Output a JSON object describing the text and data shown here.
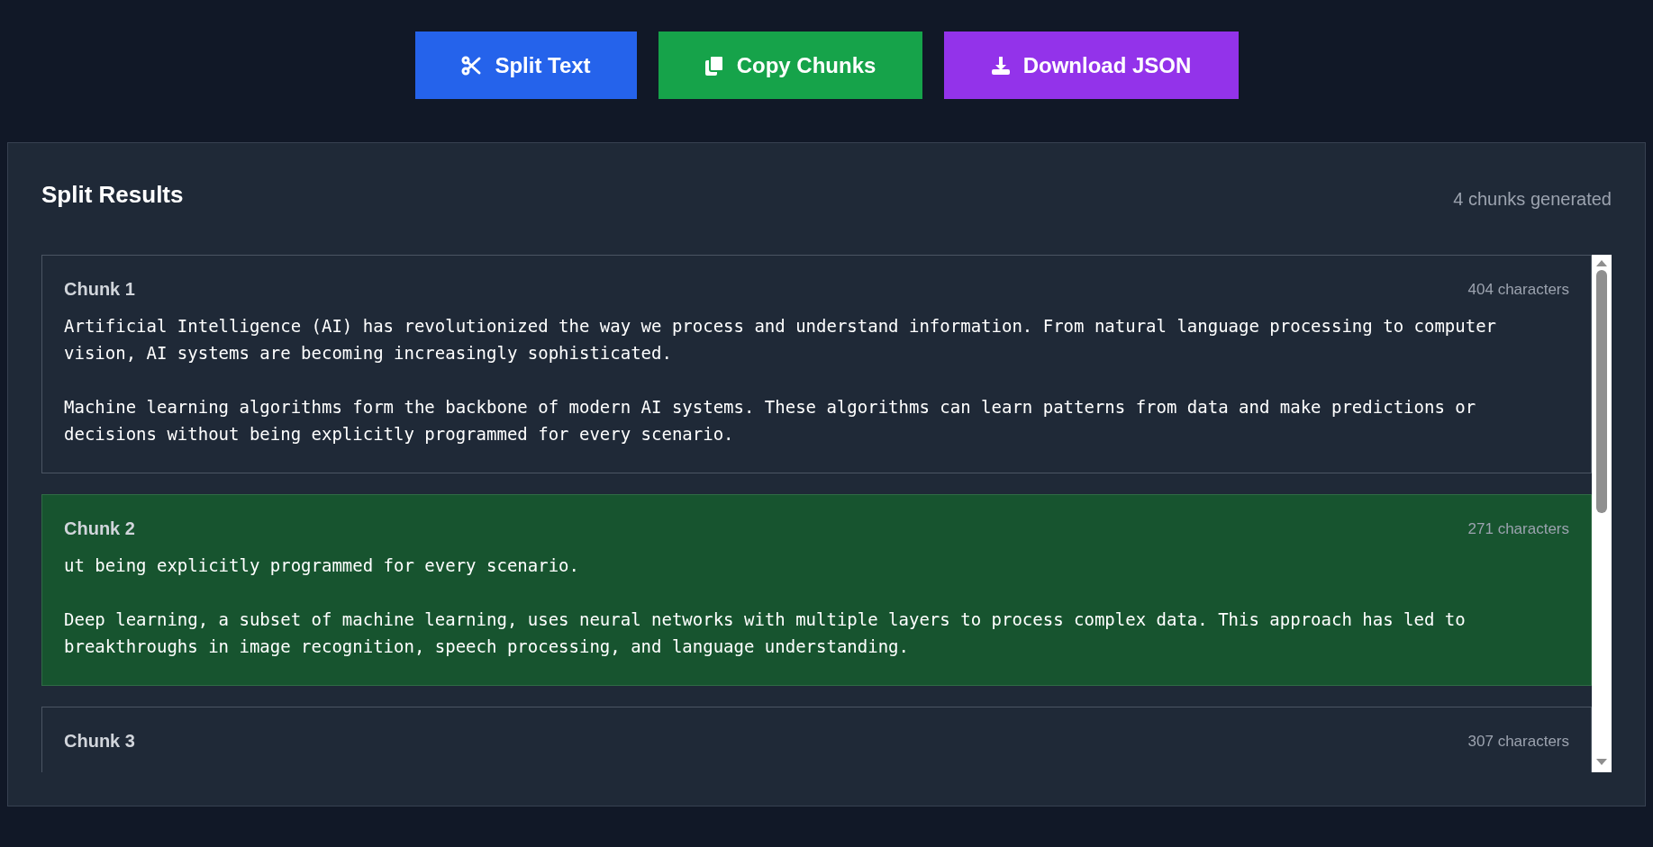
{
  "toolbar": [
    {
      "kind": "split",
      "label": "Split Text",
      "color": "#2563eb"
    },
    {
      "kind": "copy",
      "label": "Copy Chunks",
      "color": "#16a34a"
    },
    {
      "kind": "download",
      "label": "Download JSON",
      "color": "#9333ea"
    }
  ],
  "results": {
    "title": "Split Results",
    "count": "4 chunks generated",
    "chunks": [
      {
        "title": "Chunk 1",
        "length": "404 characters",
        "selected": false,
        "text": "Artificial Intelligence (AI) has revolutionized the way we process and understand information. From natural language processing to computer vision, AI systems are becoming increasingly sophisticated.\n\nMachine learning algorithms form the backbone of modern AI systems. These algorithms can learn patterns from data and make predictions or decisions without being explicitly programmed for every scenario."
      },
      {
        "title": "Chunk 2",
        "length": "271 characters",
        "selected": true,
        "text": "ut being explicitly programmed for every scenario.\n\nDeep learning, a subset of machine learning, uses neural networks with multiple layers to process complex data. This approach has led to breakthroughs in image recognition, speech processing, and language understanding."
      },
      {
        "title": "Chunk 3",
        "length": "307 characters",
        "selected": false
      }
    ]
  }
}
